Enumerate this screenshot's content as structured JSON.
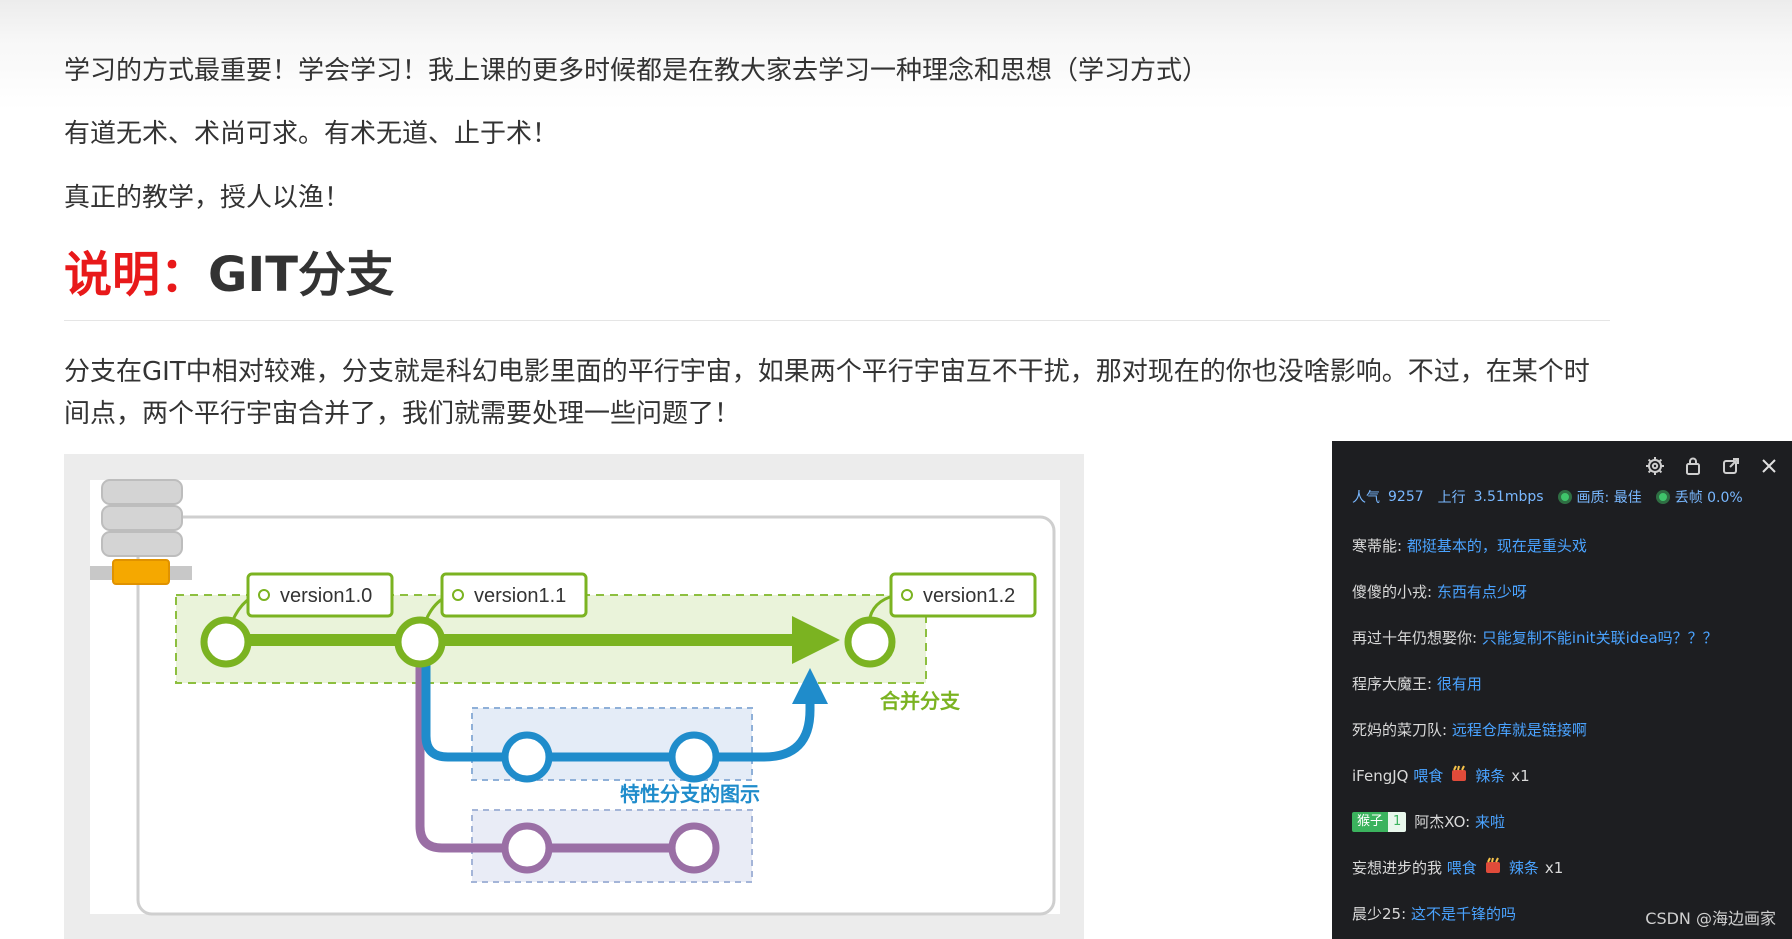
{
  "article": {
    "paragraphs": [
      "学习的方式最重要！学会学习！我上课的更多时候都是在教大家去学习一种理念和思想（学习方式）",
      "有道无术、术尚可求。有术无道、止于术！",
      "真正的教学，授人以渔！"
    ],
    "heading_accent": "说明：",
    "heading_main": "GIT分支",
    "description": "分支在GIT中相对较难，分支就是科幻电影里面的平行宇宙，如果两个平行宇宙互不干扰，那对现在的你也没啥影响。不过，在某个时间点，两个平行宇宙合并了，我们就需要处理一些问题了！"
  },
  "diagram": {
    "tags": [
      "version1.0",
      "version1.1",
      "version1.2"
    ],
    "merge_label": "合并分支",
    "feature_label": "特性分支的图示",
    "colors": {
      "main": "#7bb321",
      "feature": "#1f8ccb",
      "purple": "#9a6fa5",
      "tag_border": "#7bb321",
      "db": "#d9d9d9",
      "db_band": "#f5a800"
    }
  },
  "live_panel": {
    "toolbar_icons": [
      "settings-icon",
      "lock-icon",
      "popout-icon",
      "close-icon"
    ],
    "stats": {
      "popularity_label": "人气",
      "popularity_value": "9257",
      "upload_label": "上行",
      "upload_value": "3.51mbps",
      "quality": "画质: 最佳",
      "dropped": "丢帧 0.0%"
    },
    "messages": [
      {
        "user": "寒蒂能:",
        "text": "都挺基本的，现在是重头戏"
      },
      {
        "user": "傻傻的小戎:",
        "text": "东西有点少呀"
      },
      {
        "user": "再过十年仍想娶你:",
        "text": "只能复制不能init关联idea吗？？？"
      },
      {
        "user": "程序大魔王:",
        "text": "很有用"
      },
      {
        "user": "死妈的菜刀队:",
        "text": "远程仓库就是链接啊"
      },
      {
        "user": "iFengJQ",
        "text": "喂食",
        "gift": "辣条",
        "count": "x1"
      },
      {
        "user": "阿杰XO:",
        "text": "来啦",
        "badge": "猴子",
        "badge_level": "1"
      },
      {
        "user": "妄想进步的我",
        "text": "喂食",
        "gift": "辣条",
        "count": "x1"
      },
      {
        "user": "晨少25:",
        "text": "这不是千锋的吗"
      }
    ]
  },
  "watermark": "CSDN @海边画家"
}
